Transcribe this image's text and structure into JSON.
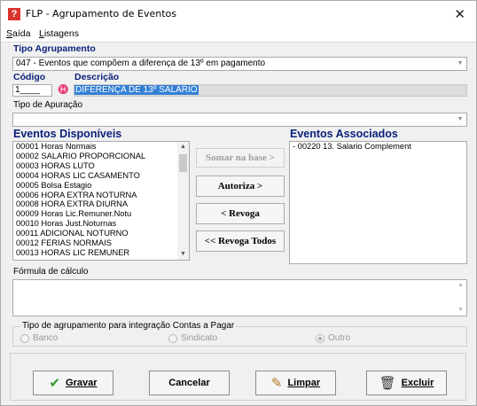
{
  "window": {
    "title": "FLP - Agrupamento de Eventos",
    "app_icon": "?"
  },
  "menu": [
    {
      "prefix": "",
      "accel": "S",
      "rest": "aída"
    },
    {
      "prefix": "",
      "accel": "L",
      "rest": "istagens"
    }
  ],
  "tipo_agrupamento": {
    "label": "Tipo Agrupamento",
    "value": "047 - Eventos que compõem a diferença de 13º em pagamento"
  },
  "codigo": {
    "label": "Código",
    "value": "1____"
  },
  "descricao": {
    "label": "Descrição",
    "value": "DIFERENÇA DE 13º SALARIO"
  },
  "tipo_apuracao": {
    "label": "Tipo de Apuração",
    "value": ""
  },
  "eventos_disponiveis": {
    "label": "Eventos Disponíveis",
    "items": [
      "00001 Horas Normais",
      "00002 SALARIO PROPORCIONAL",
      "00003 HORAS LUTO",
      "00004 HORAS LIC CASAMENTO",
      "00005 Bolsa Estagio",
      "00006 HORA EXTRA NOTURNA",
      "00008 HORA EXTRA DIURNA",
      "00009 Horas Lic.Remuner.Notu",
      "00010 Horas Just.Noturnas",
      "00011 ADICIONAL NOTURNO",
      "00012 FERIAS NORMAIS",
      "00013 HORAS LIC REMUNER"
    ]
  },
  "eventos_associados": {
    "label": "Eventos Associados",
    "items": [
      "- 00220 13. Salario Complement"
    ]
  },
  "transfer_buttons": {
    "somar": "Somar na base >",
    "autoriza": "Autoriza >",
    "revoga": "< Revoga",
    "revoga_todos": "<< Revoga Todos"
  },
  "formula": {
    "label": "Fórmula de cálculo",
    "value": ""
  },
  "integracao": {
    "label": "Tipo de agrupamento para integração Contas a Pagar",
    "options": [
      "Banco",
      "Sindicato",
      "Outro"
    ],
    "selected": "Outro"
  },
  "actions": {
    "gravar": "Gravar",
    "cancelar": "Cancelar",
    "limpar": "Limpar",
    "excluir": "Excluir"
  }
}
